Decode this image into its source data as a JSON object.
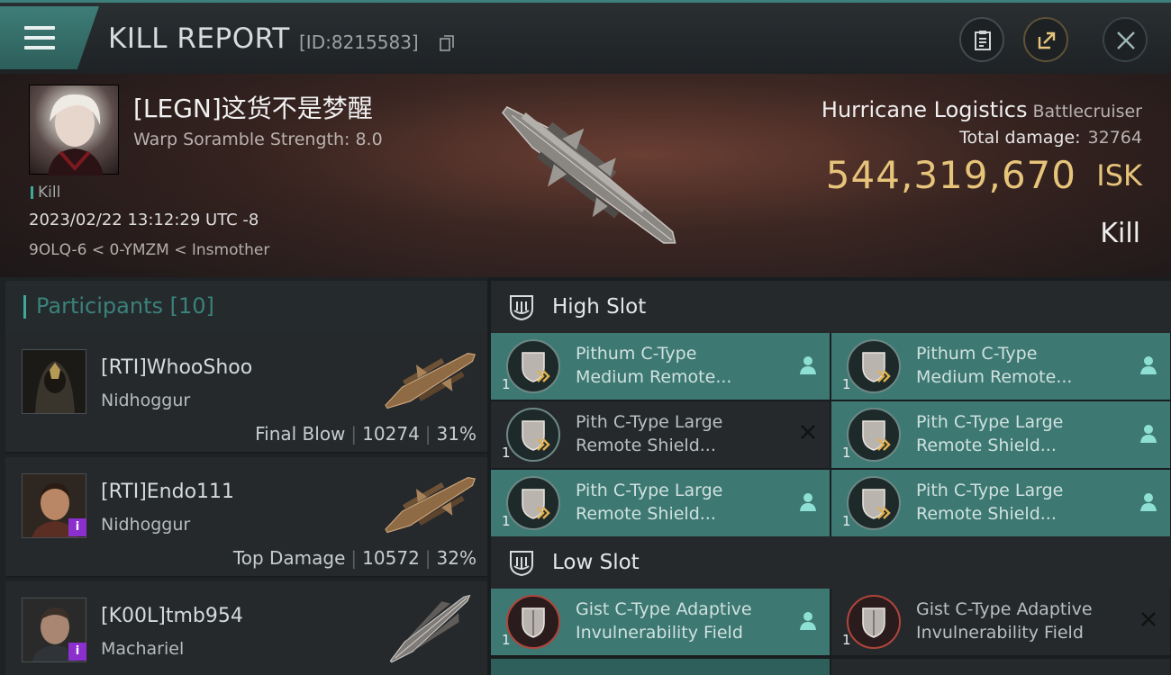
{
  "header": {
    "title": "KILL REPORT",
    "report_id": "[ID:8215583]",
    "menu_icon": "hamburger-icon",
    "buttons": [
      "clipboard-icon",
      "share-icon",
      "close-icon"
    ]
  },
  "victim": {
    "name": "[LEGN]这货不是梦醒",
    "warp_scramble": "Warp Soramble Strength: 8.0",
    "role": "Kill",
    "datetime": "2023/02/22 13:12:29 UTC -8",
    "location": "9OLQ-6 < 0-YMZM < Insmother",
    "ship_name": "Hurricane Logistics",
    "ship_class": "Battlecruiser",
    "total_damage_label": "Total damage:",
    "total_damage": "32764",
    "isk_value": "544,319,670",
    "isk_unit": "ISK",
    "result": "Kill"
  },
  "participants": {
    "label": "Participants [10]",
    "rows": [
      {
        "name": "[RTI]WhooShoo",
        "ship": "Nidhoggur",
        "tag": "Final Blow",
        "damage": "10274",
        "percent": "31%"
      },
      {
        "name": "[RTI]Endo111",
        "ship": "Nidhoggur",
        "tag": "Top Damage",
        "damage": "10572",
        "percent": "32%"
      },
      {
        "name": "[K00L]tmb954",
        "ship": "Machariel",
        "tag": "",
        "damage": "",
        "percent": ""
      }
    ]
  },
  "slots": {
    "high": {
      "label": "High Slot",
      "modules": [
        {
          "qty": "1",
          "line1": "Pithum C-Type",
          "line2": "Medium Remote...",
          "state": "dropped"
        },
        {
          "qty": "1",
          "line1": "Pithum C-Type",
          "line2": "Medium Remote...",
          "state": "dropped"
        },
        {
          "qty": "1",
          "line1": "Pith C-Type Large",
          "line2": "Remote Shield...",
          "state": "destroyed"
        },
        {
          "qty": "1",
          "line1": "Pith C-Type Large",
          "line2": "Remote Shield...",
          "state": "dropped"
        },
        {
          "qty": "1",
          "line1": "Pith C-Type Large",
          "line2": "Remote Shield...",
          "state": "dropped"
        },
        {
          "qty": "1",
          "line1": "Pith C-Type Large",
          "line2": "Remote Shield...",
          "state": "dropped"
        }
      ]
    },
    "low": {
      "label": "Low Slot",
      "modules": [
        {
          "qty": "1",
          "line1": "Gist C-Type Adaptive",
          "line2": "Invulnerability Field",
          "state": "dropped"
        },
        {
          "qty": "1",
          "line1": "Gist C-Type Adaptive",
          "line2": "Invulnerability Field",
          "state": "destroyed"
        }
      ]
    }
  },
  "colors": {
    "accent": "#3d7872",
    "isk": "#e6c47a",
    "teal_text": "#3a827b"
  }
}
